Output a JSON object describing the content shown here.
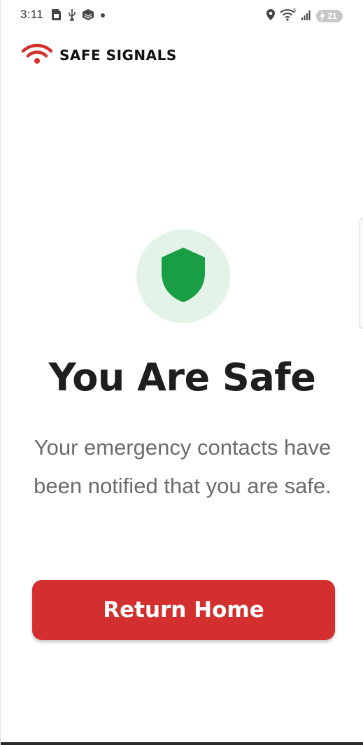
{
  "status_bar": {
    "time": "3:11",
    "battery": "21",
    "icons_left": [
      "sim-card-icon",
      "usb-icon",
      "app-notification-icon",
      "dot-icon"
    ],
    "icons_right": [
      "location-icon",
      "wifi-icon",
      "signal-icon",
      "battery-icon"
    ]
  },
  "header": {
    "brand_name": "SAFE SIGNALS",
    "logo_icon": "wifi-signal-logo-icon"
  },
  "main": {
    "status_icon": "shield-icon",
    "title": "You Are Safe",
    "message": "Your emergency contacts have been notified that you are safe.",
    "button_label": "Return Home"
  },
  "colors": {
    "brand_red": "#d32f2f",
    "shield_green": "#1a9e45",
    "shield_circle_bg": "#e3f3e7",
    "title_text": "#1e1e1e",
    "message_text": "#6b6b6b"
  }
}
